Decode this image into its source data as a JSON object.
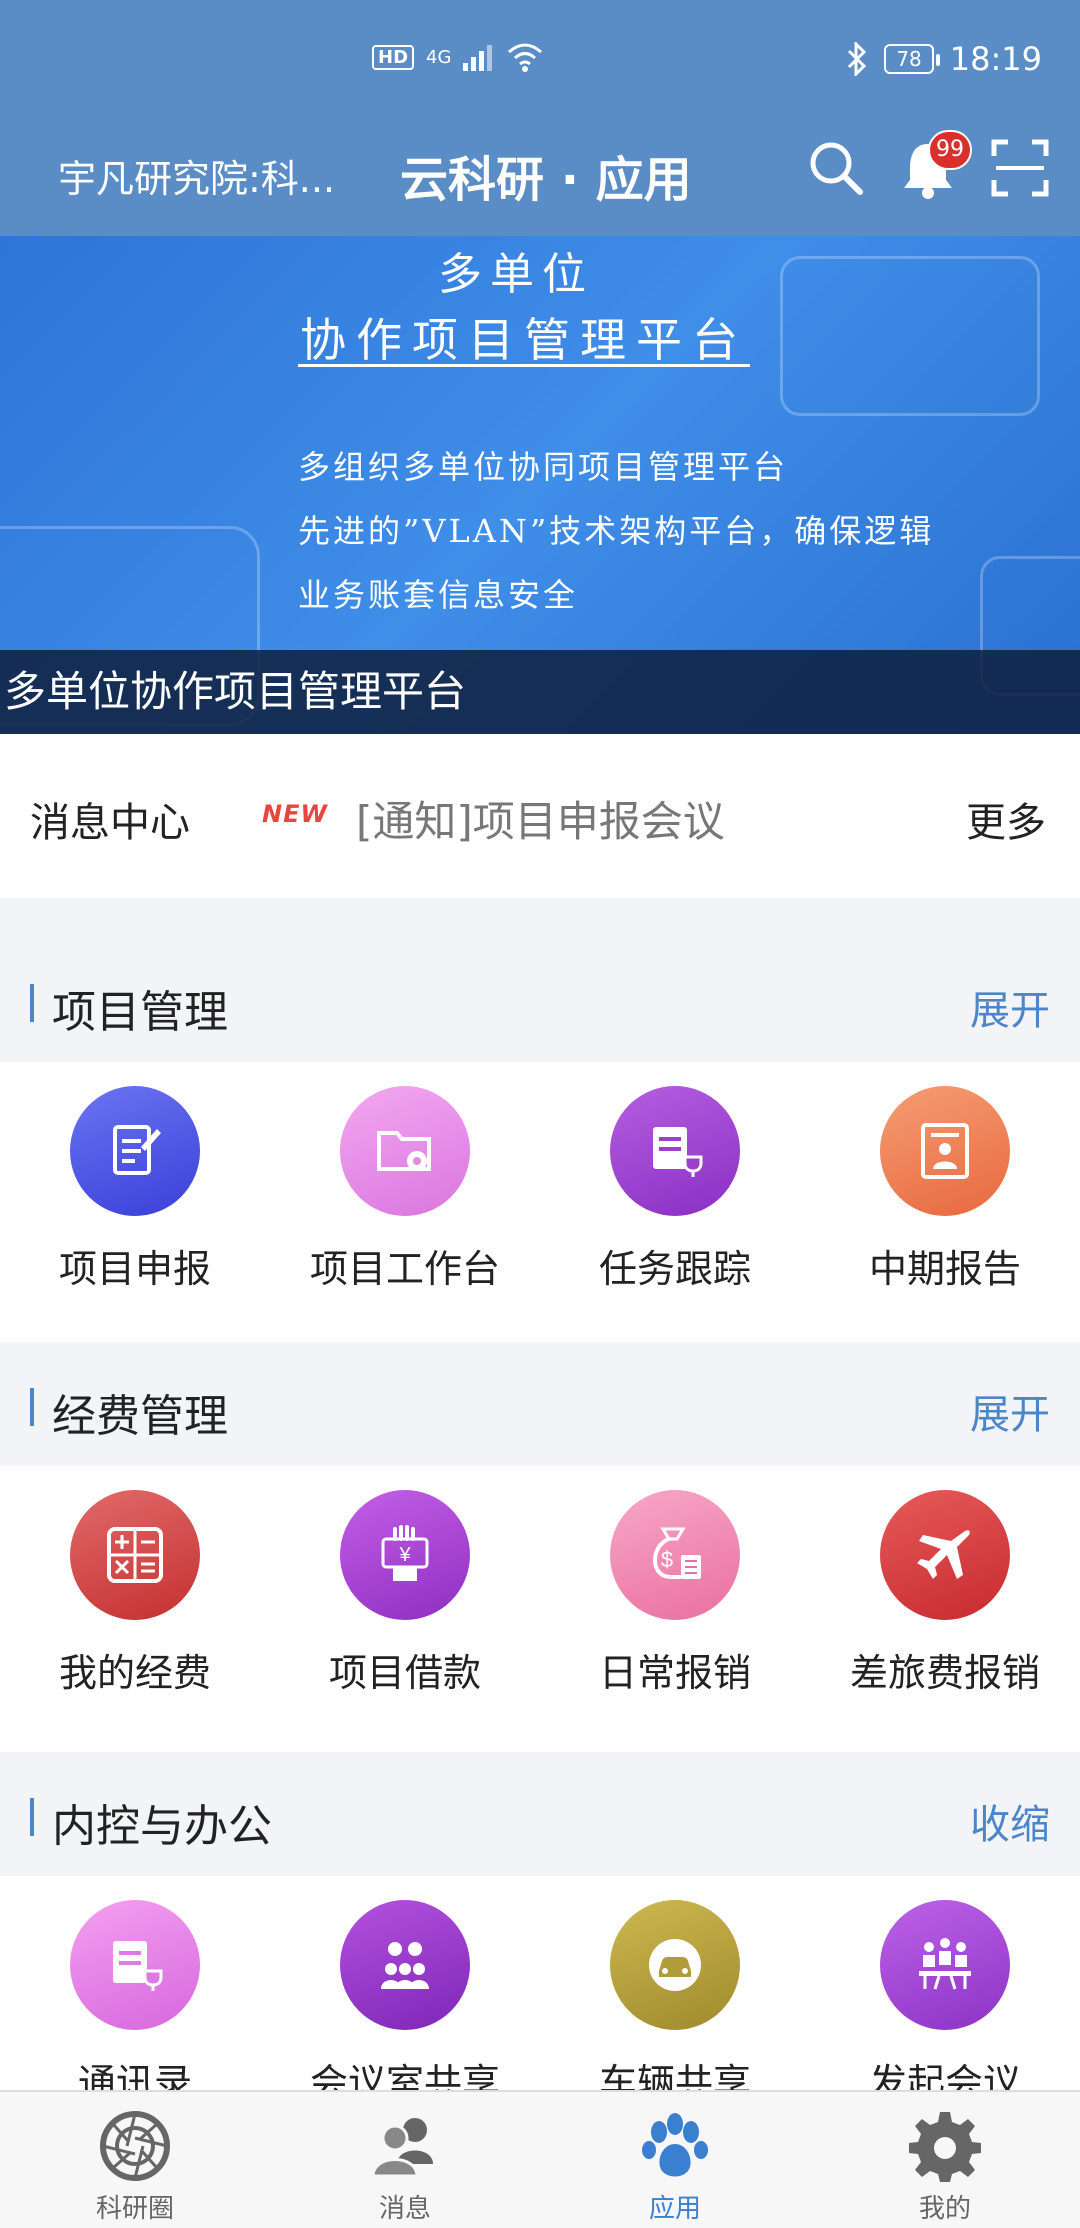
{
  "status_bar": {
    "network": "4G",
    "battery": "78",
    "time": "18:19"
  },
  "header": {
    "org": "宇凡研究院:科...",
    "title": "云科研 · 应用",
    "notif_count": "99"
  },
  "banner": {
    "line1": "多单位",
    "line2": "协作项目管理平台",
    "desc1": "多组织多单位协同项目管理平台",
    "desc2": "先进的”VLAN”技术架构平台，确保逻辑",
    "desc3": "业务账套信息安全",
    "caption": "多单位协作项目管理平台"
  },
  "messages": {
    "label": "消息中心",
    "new_tag": "NEW",
    "text": "[通知]项目申报会议",
    "more": "更多"
  },
  "sections": [
    {
      "title": "项目管理",
      "action": "展开",
      "items": [
        {
          "label": "项目申报",
          "icon": "edit-doc-icon",
          "color": "#4a55e6"
        },
        {
          "label": "项目工作台",
          "icon": "folder-gear-icon",
          "color": "#e58ce8"
        },
        {
          "label": "任务跟踪",
          "icon": "task-trophy-icon",
          "color": "#9b3fcf"
        },
        {
          "label": "中期报告",
          "icon": "report-person-icon",
          "color": "#f07d54"
        }
      ]
    },
    {
      "title": "经费管理",
      "action": "展开",
      "items": [
        {
          "label": "我的经费",
          "icon": "calculator-icon",
          "color": "#d34848"
        },
        {
          "label": "项目借款",
          "icon": "hand-yuan-icon",
          "color": "#a43fcc"
        },
        {
          "label": "日常报销",
          "icon": "money-bag-icon",
          "color": "#f08ab0"
        },
        {
          "label": "差旅费报销",
          "icon": "airplane-icon",
          "color": "#d6363a"
        }
      ]
    },
    {
      "title": "内控与办公",
      "action": "收缩",
      "items": [
        {
          "label": "通讯录",
          "icon": "contacts-icon",
          "color": "#e27ae8"
        },
        {
          "label": "会议室共享",
          "icon": "meeting-room-icon",
          "color": "#8e35c6"
        },
        {
          "label": "车辆共享",
          "icon": "car-icon",
          "color": "#b7a13c"
        },
        {
          "label": "发起会议",
          "icon": "start-meeting-icon",
          "color": "#9b45d0"
        }
      ]
    }
  ],
  "nav": [
    {
      "label": "科研圈",
      "icon": "aperture-icon"
    },
    {
      "label": "消息",
      "icon": "users-icon"
    },
    {
      "label": "应用",
      "icon": "paw-icon",
      "active": true
    },
    {
      "label": "我的",
      "icon": "gear-icon"
    }
  ]
}
